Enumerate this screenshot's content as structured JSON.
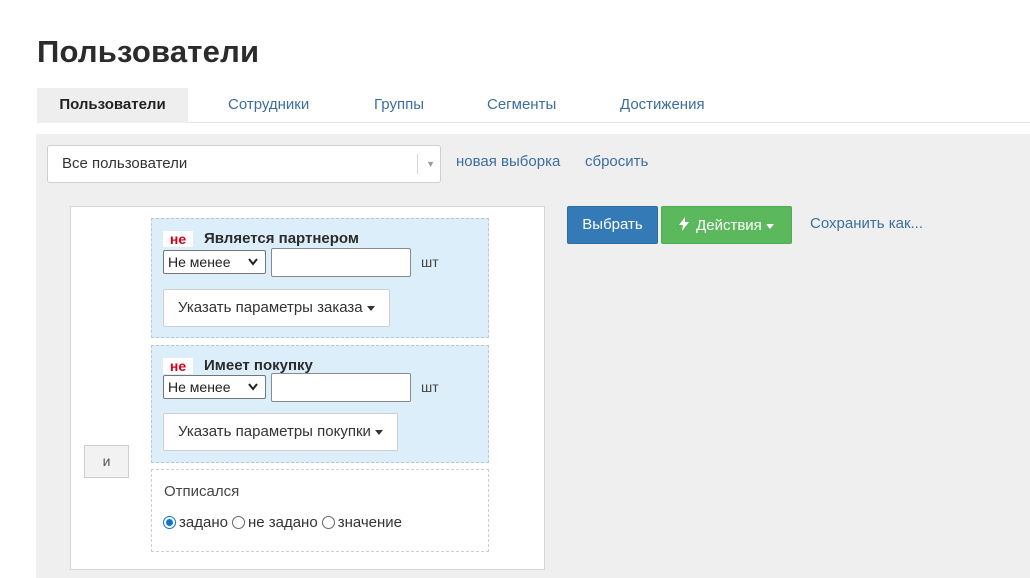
{
  "page": {
    "title": "Пользователи"
  },
  "tabs": [
    {
      "label": "Пользователи",
      "active": true
    },
    {
      "label": "Сотрудники"
    },
    {
      "label": "Группы"
    },
    {
      "label": "Сегменты"
    },
    {
      "label": "Достижения"
    }
  ],
  "segment_select": {
    "value": "Все пользователи",
    "arrow_icon": "triangle-down-icon"
  },
  "links": {
    "new_selection": "новая выборка",
    "reset": "сбросить"
  },
  "logic_operator": "и",
  "conditions": [
    {
      "negation": "не",
      "title": "Является партнером",
      "comparator": "Не менее",
      "value": "",
      "unit": "шт",
      "params_button": "Указать параметры заказа"
    },
    {
      "negation": "не",
      "title": "Имеет покупку",
      "comparator": "Не менее",
      "value": "",
      "unit": "шт",
      "params_button": "Указать параметры покупки"
    }
  ],
  "unsubscribed": {
    "label": "Отписался",
    "options": [
      "задано",
      "не задано",
      "значение"
    ],
    "selected": "задано"
  },
  "actions": {
    "select_button": "Выбрать",
    "actions_button": "Действия",
    "actions_icon": "bolt-icon",
    "save_as": "Сохранить как..."
  },
  "colors": {
    "primary": "#337ab7",
    "success": "#5cb85c",
    "link": "#3c6e9f",
    "negation": "#d0021b",
    "condition_bg": "#ddeefb"
  }
}
